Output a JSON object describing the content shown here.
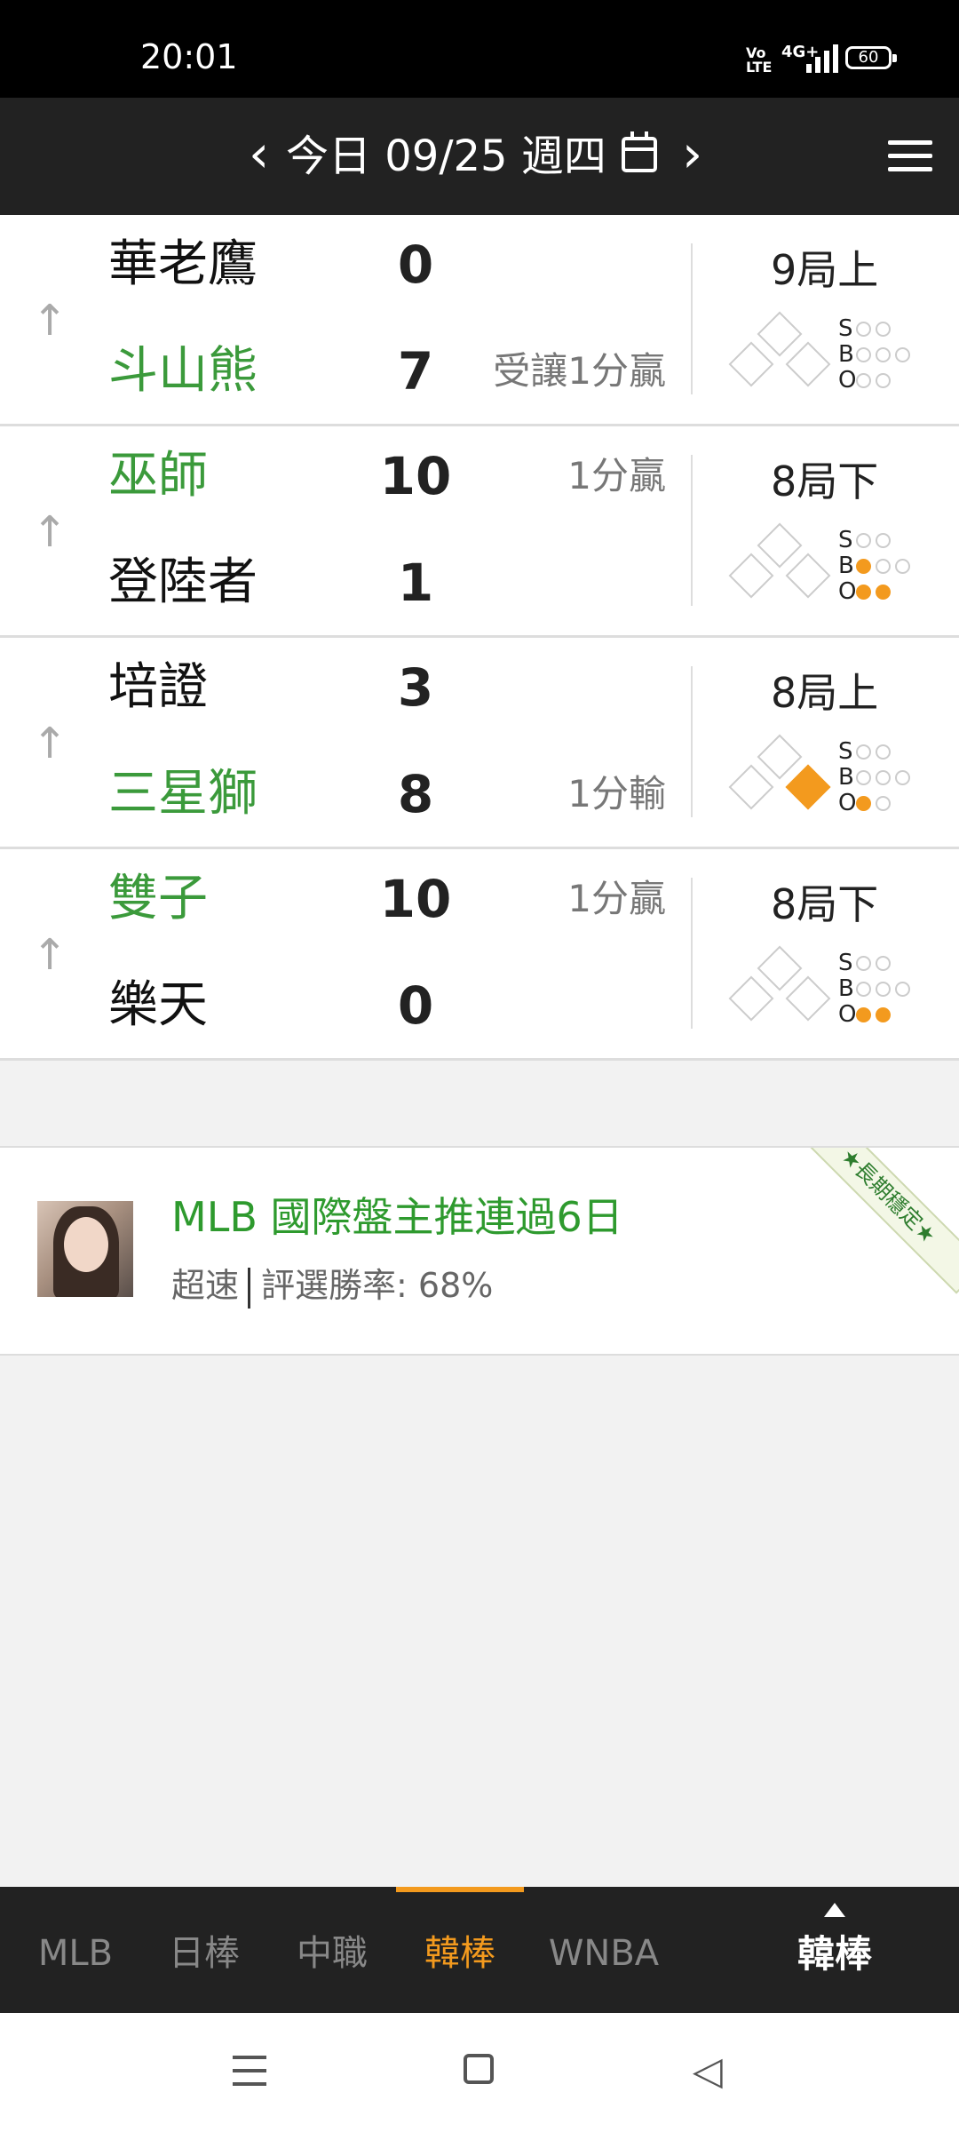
{
  "status_bar": {
    "time": "20:01",
    "volte": "Vo LTE",
    "network": "4G+",
    "battery": "60"
  },
  "header": {
    "prev_icon": "‹",
    "date_label": "今日 09/25 週四",
    "next_icon": "›"
  },
  "games": [
    {
      "team1": "華老鷹",
      "team1_green": false,
      "score1": "0",
      "result1": "",
      "team2": "斗山熊",
      "team2_green": true,
      "score2": "7",
      "result2": "受讓1分贏",
      "inning": "9局上",
      "bases": {
        "first": false,
        "second": false,
        "third": false
      },
      "sbo": {
        "s": 0,
        "b": 0,
        "o": 0
      }
    },
    {
      "team1": "巫師",
      "team1_green": true,
      "score1": "10",
      "result1": "1分贏",
      "team2": "登陸者",
      "team2_green": false,
      "score2": "1",
      "result2": "",
      "inning": "8局下",
      "bases": {
        "first": false,
        "second": false,
        "third": false
      },
      "sbo": {
        "s": 0,
        "b": 1,
        "o": 2
      }
    },
    {
      "team1": "培證",
      "team1_green": false,
      "score1": "3",
      "result1": "",
      "team2": "三星獅",
      "team2_green": true,
      "score2": "8",
      "result2": "1分輸",
      "inning": "8局上",
      "bases": {
        "first": true,
        "second": false,
        "third": false
      },
      "sbo": {
        "s": 0,
        "b": 0,
        "o": 1
      }
    },
    {
      "team1": "雙子",
      "team1_green": true,
      "score1": "10",
      "result1": "1分贏",
      "team2": "樂天",
      "team2_green": false,
      "score2": "0",
      "result2": "",
      "inning": "8局下",
      "bases": {
        "first": false,
        "second": false,
        "third": false
      },
      "sbo": {
        "s": 0,
        "b": 0,
        "o": 2
      }
    }
  ],
  "sbo_labels": {
    "s": "S",
    "b": "B",
    "o": "O"
  },
  "ad": {
    "title": "MLB 國際盤主推連過6日",
    "tag": "超速",
    "win_rate": "評選勝率: 68%",
    "ribbon": "★長期穩定★"
  },
  "tabs": [
    {
      "label": "MLB",
      "active": false
    },
    {
      "label": "日棒",
      "active": false
    },
    {
      "label": "中職",
      "active": false
    },
    {
      "label": "韓棒",
      "active": true
    },
    {
      "label": "WNBA",
      "active": false
    }
  ],
  "tab_more_label": "韓棒",
  "colors": {
    "green": "#3b9a3b",
    "accent": "#f39a1e",
    "header_bg": "#222222"
  }
}
